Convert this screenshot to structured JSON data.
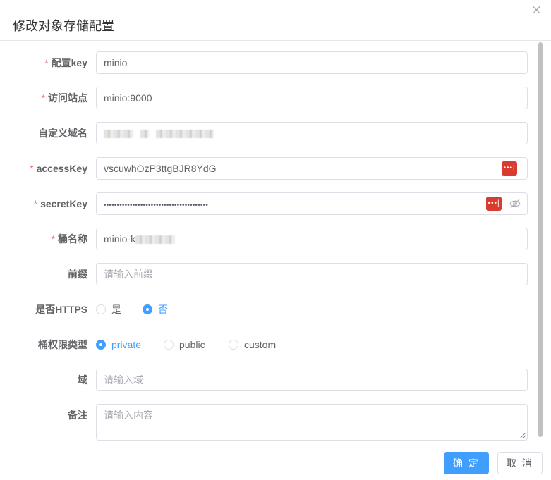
{
  "dialog": {
    "title": "修改对象存储配置"
  },
  "form": {
    "config_key": {
      "label": "配置key",
      "required": true,
      "value": "minio"
    },
    "endpoint": {
      "label": "访问站点",
      "required": true,
      "value": "minio:9000"
    },
    "domain": {
      "label": "自定义域名",
      "required": false,
      "value": ""
    },
    "access_key": {
      "label": "accessKey",
      "required": true,
      "value": "vscuwhOzP3ttgBJR8YdG"
    },
    "secret_key": {
      "label": "secretKey",
      "required": true,
      "value": "••••••••••••••••••••••••••••••••••••••••"
    },
    "bucket": {
      "label": "桶名称",
      "required": true,
      "value": "minio-k"
    },
    "prefix": {
      "label": "前缀",
      "placeholder": "请输入前缀"
    },
    "https": {
      "label": "是否HTTPS",
      "options": [
        "是",
        "否"
      ],
      "selected": "否"
    },
    "bucket_acl": {
      "label": "桶权限类型",
      "options": [
        "private",
        "public",
        "custom"
      ],
      "selected": "private"
    },
    "region": {
      "label": "域",
      "placeholder": "请输入域"
    },
    "remark": {
      "label": "备注",
      "placeholder": "请输入内容"
    },
    "password_manager_badge": "•••|"
  },
  "footer": {
    "confirm_label": "确 定",
    "cancel_label": "取 消"
  },
  "colors": {
    "primary": "#409eff",
    "required": "#f56c6c",
    "border": "#dcdfe6",
    "badge": "#d93b2f"
  }
}
